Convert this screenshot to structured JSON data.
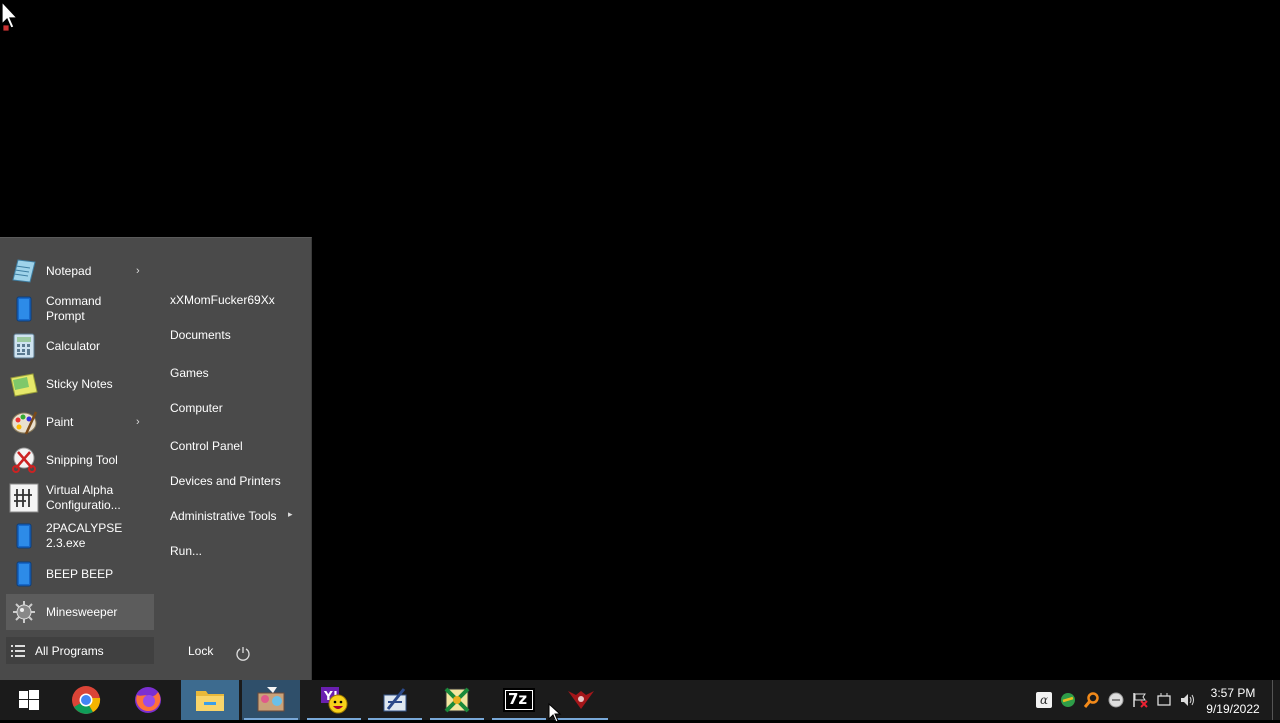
{
  "start_menu": {
    "pinned": [
      {
        "label": "Notepad",
        "icon": "notepad-icon",
        "has_submenu": true
      },
      {
        "label": "Command\nPrompt",
        "icon": "command-prompt-icon",
        "has_submenu": false
      },
      {
        "label": "Calculator",
        "icon": "calculator-icon",
        "has_submenu": false
      },
      {
        "label": "Sticky Notes",
        "icon": "sticky-notes-icon",
        "has_submenu": false
      },
      {
        "label": "Paint",
        "icon": "paint-icon",
        "has_submenu": true
      },
      {
        "label": "Snipping Tool",
        "icon": "snipping-tool-icon",
        "has_submenu": false
      },
      {
        "label": "Virtual Alpha\nConfiguratio...",
        "icon": "virtual-alpha-icon",
        "has_submenu": false
      },
      {
        "label": "2PACALYPSE\n2.3.exe",
        "icon": "exe-icon",
        "has_submenu": false
      },
      {
        "label": "BEEP BEEP",
        "icon": "exe-icon",
        "has_submenu": false
      },
      {
        "label": "Minesweeper",
        "icon": "minesweeper-icon",
        "has_submenu": false
      }
    ],
    "all_programs": "All Programs",
    "places": [
      {
        "label": "xXMomFucker69Xx"
      },
      {
        "label": "Documents"
      },
      {
        "label": "Games"
      },
      {
        "label": "Computer"
      },
      {
        "label": "Control Panel"
      },
      {
        "label": "Devices and Printers"
      },
      {
        "label": "Administrative Tools",
        "has_submenu": true
      },
      {
        "label": "Run..."
      }
    ],
    "lock_label": "Lock",
    "submenu_arrow": "›",
    "places_arrow": "▸"
  },
  "taskbar": {
    "apps": [
      {
        "name": "start-button",
        "icon": "windows-logo-icon"
      },
      {
        "name": "chrome",
        "icon": "chrome-icon"
      },
      {
        "name": "firefox",
        "icon": "firefox-icon"
      },
      {
        "name": "file-explorer",
        "icon": "folder-icon"
      },
      {
        "name": "app-4",
        "icon": "app-icon"
      },
      {
        "name": "yahoo-messenger",
        "icon": "yahoo-messenger-icon"
      },
      {
        "name": "app-6",
        "icon": "app-icon"
      },
      {
        "name": "app-7",
        "icon": "app-icon"
      },
      {
        "name": "7zip",
        "icon": "7zip-icon",
        "text": "7z"
      },
      {
        "name": "app-9",
        "icon": "app-icon"
      }
    ],
    "tray_icons": [
      "input-method-icon",
      "network-app-icon",
      "search-app-icon",
      "app-tray-icon",
      "flag-icon",
      "action-center-icon",
      "volume-icon"
    ],
    "clock": {
      "time": "3:57 PM",
      "date": "9/19/2022"
    }
  }
}
